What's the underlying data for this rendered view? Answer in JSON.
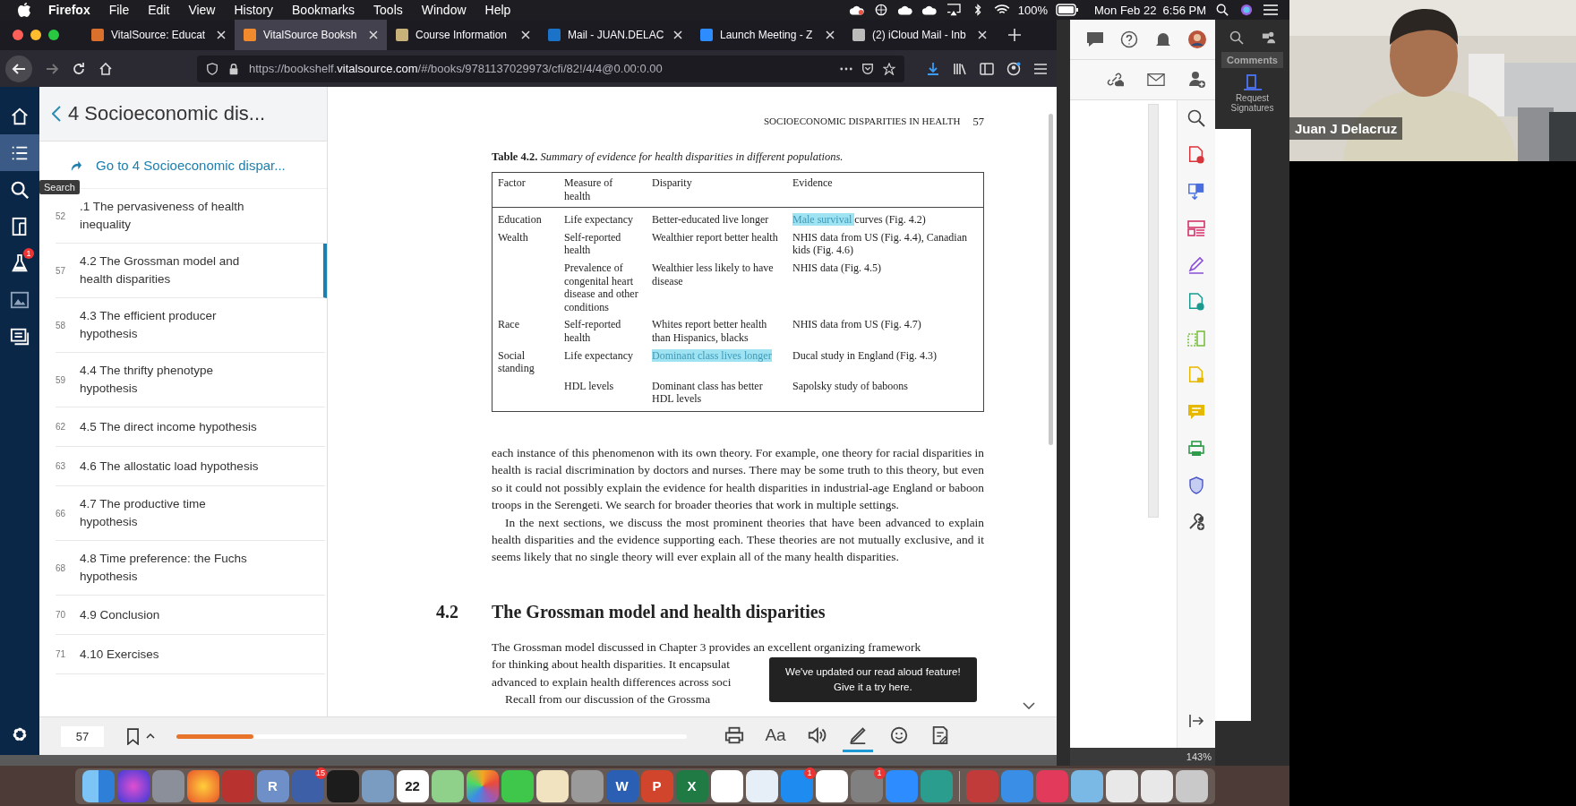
{
  "menubar": {
    "menus": [
      "Firefox",
      "File",
      "Edit",
      "View",
      "History",
      "Bookmarks",
      "Tools",
      "Window",
      "Help"
    ],
    "battery": "100%",
    "clock": "Mon Feb 22  6:56 PM"
  },
  "browser": {
    "tabs": [
      {
        "title": "VitalSource: Educat",
        "kind": "vitalsource",
        "selected": false
      },
      {
        "title": "VitalSource Booksh",
        "kind": "bookshelf",
        "selected": true
      },
      {
        "title": "Course Information",
        "kind": "blackboard",
        "selected": false
      },
      {
        "title": "Mail - JUAN.DELAC",
        "kind": "mail",
        "selected": false
      },
      {
        "title": "Launch Meeting - Z",
        "kind": "video",
        "selected": false
      },
      {
        "title": "(2) iCloud Mail - Inb",
        "kind": "apple",
        "selected": false
      }
    ],
    "url_prefix": "https://bookshelf.",
    "url_domain": "vitalsource.com",
    "url_rest": "/#/books/9781137029973/cfi/82!/4/4@0.00:0.00"
  },
  "reader": {
    "rail": [
      {
        "kind": "home",
        "selected": false
      },
      {
        "kind": "contents",
        "selected": true
      },
      {
        "kind": "search",
        "selected": false
      },
      {
        "kind": "flashcards",
        "selected": false
      },
      {
        "kind": "flask",
        "selected": false,
        "badge": "1"
      },
      {
        "kind": "figures",
        "selected": false
      },
      {
        "kind": "notes",
        "selected": false
      }
    ],
    "tooltip": "Search",
    "toc": {
      "title": "4 Socioeconomic dis...",
      "goto": "Go to 4 Socioeconomic dispar...",
      "items": [
        {
          "page": "52",
          "title": ".1 The pervasiveness of health inequality",
          "selected": false
        },
        {
          "page": "57",
          "title": "4.2 The Grossman model and health disparities",
          "selected": true
        },
        {
          "page": "58",
          "title": "4.3 The efficient producer hypothesis",
          "selected": false
        },
        {
          "page": "59",
          "title": "4.4 The thrifty phenotype hypothesis",
          "selected": false
        },
        {
          "page": "62",
          "title": "4.5 The direct income hypothesis",
          "selected": false
        },
        {
          "page": "63",
          "title": "4.6 The allostatic load hypothesis",
          "selected": false
        },
        {
          "page": "66",
          "title": "4.7 The productive time hypothesis",
          "selected": false
        },
        {
          "page": "68",
          "title": "4.8 Time preference: the Fuchs hypothesis",
          "selected": false
        },
        {
          "page": "70",
          "title": "4.9 Conclusion",
          "selected": false
        },
        {
          "page": "71",
          "title": "4.10 Exercises",
          "selected": false
        }
      ]
    },
    "page": {
      "running_head": "SOCIOECONOMIC DISPARITIES IN HEALTH",
      "page_number": "57",
      "caption": "**Table 4.2.**  *Summary of evidence for health disparities in different populations.*",
      "columns": [
        "Factor",
        "Measure of health",
        "Disparity",
        "Evidence"
      ],
      "rows": [
        {
          "factor": "Education",
          "measure": "Life expectancy",
          "disparity": [
            {
              "text": "Better-educated live longer",
              "highlighted": false
            }
          ],
          "evidence": [
            {
              "text": "Male survival ",
              "highlighted": true
            },
            {
              "text": "curves (Fig. 4.2)",
              "highlighted": false
            }
          ]
        },
        {
          "factor": "Wealth",
          "measure": "Self-reported health",
          "disparity": [
            {
              "text": "Wealthier report better health",
              "highlighted": false
            }
          ],
          "evidence": [
            {
              "text": "NHIS data from US (Fig. 4.4), Canadian kids (Fig. 4.6)",
              "highlighted": false
            }
          ]
        },
        {
          "measure": "Prevalence of congenital heart disease and other conditions",
          "disparity": [
            {
              "text": "Wealthier less likely to have disease",
              "highlighted": false
            }
          ],
          "evidence": [
            {
              "text": "NHIS data (Fig. 4.5)",
              "highlighted": false
            }
          ]
        },
        {
          "factor": "Race",
          "measure": "Self-reported health",
          "disparity": [
            {
              "text": "Whites report better health than Hispanics, blacks",
              "highlighted": false
            }
          ],
          "evidence": [
            {
              "text": "NHIS data from US (Fig. 4.7)",
              "highlighted": false
            }
          ]
        },
        {
          "factor": "Social standing",
          "measure": "Life expectancy",
          "disparity": [
            {
              "text": "Dominant class lives longer",
              "highlighted": true
            }
          ],
          "evidence": [
            {
              "text": "Ducal study in England (Fig. 4.3)",
              "highlighted": false
            }
          ]
        },
        {
          "measure": "HDL levels",
          "disparity": [
            {
              "text": "Dominant class has better HDL levels",
              "highlighted": false
            }
          ],
          "evidence": [
            {
              "text": "Sapolsky study of baboons",
              "highlighted": false
            }
          ]
        }
      ],
      "paragraphs": [
        "each instance of this phenomenon with its own theory. For example, one theory for racial disparities in health is racial discrimination by doctors and nurses. There may be some truth to this theory, but even so it could not possibly explain the evidence for health disparities in industrial-age England or baboon troops in the Serengeti. We search for broader theories that work in multiple settings.",
        "In the next sections, we discuss the most prominent theories that have been advanced to explain health disparities and the evidence supporting each. These theories are not mutually exclusive, and it seems likely that no single theory will ever explain all of the many health disparities."
      ],
      "section_number": "4.2",
      "section_title": "The Grossman model and health disparities",
      "visible_lines": [
        "The Grossman model discussed in Chapter 3 provides an excellent organizing framework",
        "for thinking about health disparities. It encapsulat",
        "advanced to explain health differences across soci",
        "Recall from our discussion of the Grossma"
      ]
    },
    "popup": [
      "We've updated our read aloud feature!",
      "Give it a try here."
    ],
    "bottom": {
      "page": "57",
      "level": 0.15,
      "tools": [
        {
          "kind": "print",
          "selected": false
        },
        {
          "kind": "font",
          "label": "Aa",
          "selected": false
        },
        {
          "kind": "speaker",
          "selected": false
        },
        {
          "kind": "pen",
          "selected": true
        },
        {
          "kind": "smiley",
          "selected": false
        },
        {
          "kind": "notes",
          "selected": false
        }
      ]
    }
  },
  "acrobat": {
    "tab": "Comments",
    "action": "Request Signatures",
    "zoom": "143%"
  },
  "video": {
    "name": "Juan J Delacruz"
  },
  "dock": [
    {
      "kind": "finder"
    },
    {
      "kind": "siri"
    },
    {
      "kind": "rocket"
    },
    {
      "kind": "firefox"
    },
    {
      "kind": "shapes"
    },
    {
      "kind": "r",
      "label": "R"
    },
    {
      "kind": "grid",
      "badge": "15"
    },
    {
      "kind": "acrobat"
    },
    {
      "kind": "preview"
    },
    {
      "kind": "calendar",
      "label": "22"
    },
    {
      "kind": "maps"
    },
    {
      "kind": "photos"
    },
    {
      "kind": "facetime"
    },
    {
      "kind": "pencil"
    },
    {
      "kind": "notes"
    },
    {
      "kind": "word",
      "label": "W"
    },
    {
      "kind": "powerpoint",
      "label": "P"
    },
    {
      "kind": "excel",
      "label": "X"
    },
    {
      "kind": "numbers"
    },
    {
      "kind": "keynote"
    },
    {
      "kind": "appstore",
      "badge": "1"
    },
    {
      "kind": "music"
    },
    {
      "kind": "settings",
      "badge": "1"
    },
    {
      "kind": "zoom"
    },
    {
      "kind": "globe"
    },
    {
      "kind": "divider"
    },
    {
      "kind": "monitors"
    },
    {
      "kind": "safari"
    },
    {
      "kind": "cloud"
    },
    {
      "kind": "folder"
    },
    {
      "kind": "doc"
    },
    {
      "kind": "doc"
    },
    {
      "kind": "trash"
    }
  ]
}
